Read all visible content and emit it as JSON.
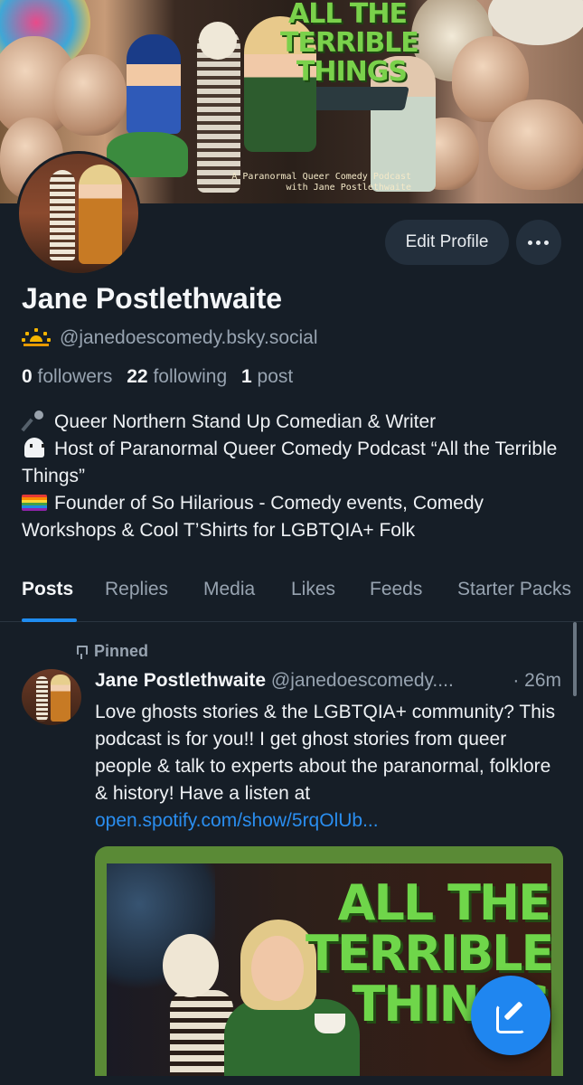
{
  "banner": {
    "title": "ALL THE TERRIBLE THINGS",
    "subtitle_line1": "A Paranormal Queer Comedy Podcast",
    "subtitle_line2": "with Jane Postlethwaite"
  },
  "header": {
    "edit_profile_label": "Edit Profile",
    "more_icon": "ellipsis-icon"
  },
  "profile": {
    "name": "Jane Postlethwaite",
    "handle_icon": "sunrise-icon",
    "handle": "@janedoescomedy.bsky.social",
    "followers_count": "0",
    "followers_label": "followers",
    "following_count": "22",
    "following_label": "following",
    "posts_count": "1",
    "posts_label": "post",
    "bio": [
      {
        "icon": "microphone-icon",
        "text": "Queer Northern Stand Up Comedian & Writer"
      },
      {
        "icon": "ghost-icon",
        "text": "Host of Paranormal Queer Comedy Podcast “All the Terrible Things”"
      },
      {
        "icon": "rainbow-flag-icon",
        "text": "Founder of So Hilarious - Comedy events, Comedy Workshops & Cool T’Shirts for LGBTQIA+ Folk"
      }
    ]
  },
  "tabs": [
    {
      "label": "Posts",
      "active": true
    },
    {
      "label": "Replies",
      "active": false
    },
    {
      "label": "Media",
      "active": false
    },
    {
      "label": "Likes",
      "active": false
    },
    {
      "label": "Feeds",
      "active": false
    },
    {
      "label": "Starter Packs",
      "active": false
    }
  ],
  "post": {
    "pinned_label": "Pinned",
    "pin_icon": "pin-icon",
    "author": "Jane Postlethwaite",
    "handle": "@janedoescomedy....",
    "time": "· 26m",
    "text": "Love ghosts stories & the LGBTQIA+ community? This podcast is for you!! I get ghost stories from queer people & talk to experts about the paranormal, folklore & history! Have a listen at ",
    "link": "open.spotify.com/show/5rqOlUb...",
    "embed_title": "ALL THE TERRIBLE THINGS"
  },
  "fab": {
    "icon": "compose-icon"
  },
  "colors": {
    "background": "#161e27",
    "accent": "#1f86f0",
    "link": "#2a8ef0",
    "muted_text": "#97a3b0",
    "banner_title_green": "#7ad14b"
  }
}
